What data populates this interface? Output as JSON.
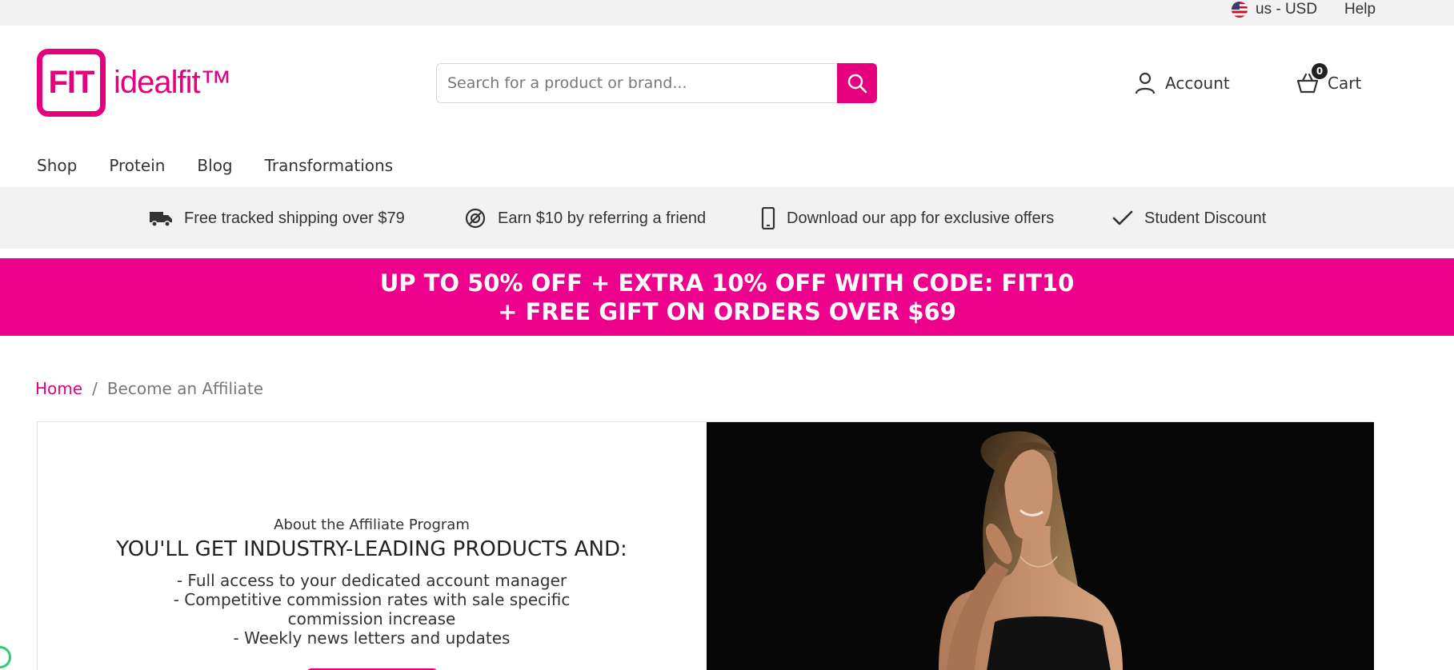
{
  "utility": {
    "currency": "us - USD",
    "help": "Help"
  },
  "header": {
    "logo_mark": "FIT",
    "logo_word": "idealfit™",
    "search_placeholder": "Search for a product or brand...",
    "search_value": "",
    "account_label": "Account",
    "cart_label": "Cart",
    "cart_count": "0"
  },
  "nav": {
    "items": [
      "Shop",
      "Protein",
      "Blog",
      "Transformations"
    ]
  },
  "benefits": [
    {
      "icon": "truck-icon",
      "text": "Free tracked shipping over $79"
    },
    {
      "icon": "referral-icon",
      "text": "Earn $10 by referring a friend"
    },
    {
      "icon": "phone-icon",
      "text": "Download our app for exclusive offers"
    },
    {
      "icon": "check-icon",
      "text": "Student Discount"
    }
  ],
  "promo": {
    "line1": "UP TO 50% OFF + EXTRA 10% OFF WITH CODE: FIT10",
    "line2": "+ FREE GIFT ON ORDERS OVER $69"
  },
  "breadcrumb": {
    "home": "Home",
    "separator": "/",
    "current": "Become an Affiliate"
  },
  "affiliate": {
    "overline": "About the Affiliate Program",
    "heading": "YOU'LL GET INDUSTRY-LEADING PRODUCTS AND:",
    "items": [
      "- Full access to your dedicated account manager",
      "- Competitive commission rates with sale specific commission increase",
      "- Weekly news letters and updates"
    ]
  },
  "colors": {
    "brand_pink": "#e6007e",
    "promo_pink": "#ec008c",
    "bar_grey": "#f2f2f2",
    "text": "#333333"
  }
}
